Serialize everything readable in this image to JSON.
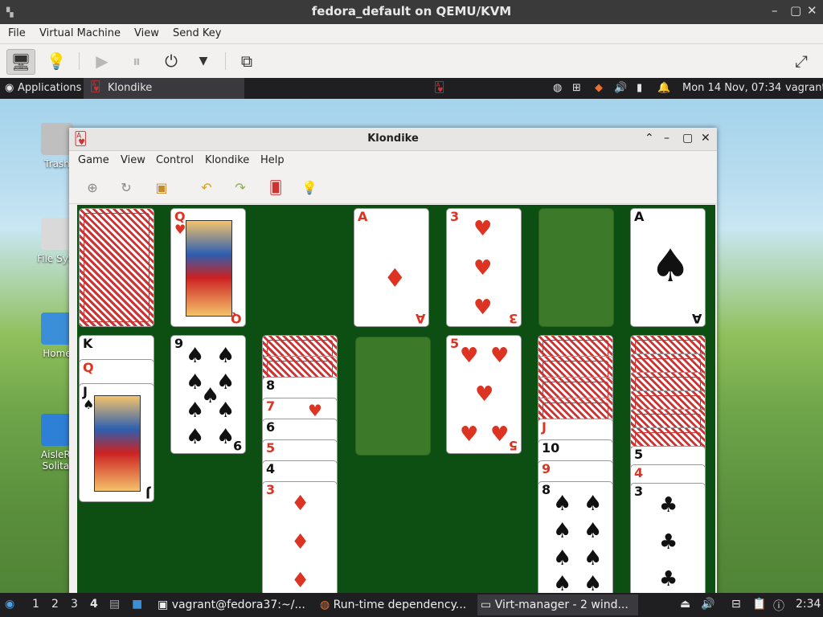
{
  "host": {
    "title": "fedora_default on QEMU/KVM",
    "menu": [
      "File",
      "Virtual Machine",
      "View",
      "Send Key"
    ]
  },
  "guest_panel": {
    "applications": "Applications",
    "active_app": "Klondike",
    "clock": "Mon 14 Nov, 07:34",
    "user": "vagrant"
  },
  "desktop_icons": [
    "Trash",
    "File Syst",
    "Home",
    "AisleRi Solitai"
  ],
  "klondike": {
    "title": "Klondike",
    "menu": [
      "Game",
      "View",
      "Control",
      "Klondike",
      "Help"
    ],
    "foundations": [
      {
        "rank": "A",
        "suit": "♦",
        "color": "red"
      },
      {
        "rank": "3",
        "suit": "♥",
        "color": "red"
      },
      {
        "rank": "",
        "suit": "",
        "color": ""
      },
      {
        "rank": "A",
        "suit": "♠",
        "color": "black"
      }
    ],
    "waste": {
      "rank": "Q",
      "suit": "♥",
      "color": "red"
    },
    "tableau": [
      {
        "visible": [
          {
            "rank": "K",
            "suit": "♠",
            "color": "black"
          },
          {
            "rank": "Q",
            "suit": "♥",
            "color": "red"
          },
          {
            "rank": "J",
            "suit": "♠",
            "color": "black"
          }
        ]
      },
      {
        "visible": [
          {
            "rank": "9",
            "suit": "♠",
            "color": "black"
          }
        ]
      },
      {
        "visible": [
          {
            "rank": "8",
            "suit": "♠",
            "color": "black"
          },
          {
            "rank": "7",
            "suit": "♥",
            "color": "red"
          },
          {
            "rank": "6",
            "suit": "♠",
            "color": "black"
          },
          {
            "rank": "5",
            "suit": "♦",
            "color": "red"
          },
          {
            "rank": "4",
            "suit": "♠",
            "color": "black"
          },
          {
            "rank": "3",
            "suit": "♦",
            "color": "red"
          }
        ]
      },
      {
        "visible": []
      },
      {
        "visible": [
          {
            "rank": "5",
            "suit": "♥",
            "color": "red"
          }
        ]
      },
      {
        "visible": [
          {
            "rank": "J",
            "suit": "♥",
            "color": "red"
          },
          {
            "rank": "10",
            "suit": "♠",
            "color": "black"
          },
          {
            "rank": "9",
            "suit": "♦",
            "color": "red"
          },
          {
            "rank": "8",
            "suit": "♠",
            "color": "black"
          }
        ]
      },
      {
        "visible": [
          {
            "rank": "5",
            "suit": "♠",
            "color": "black"
          },
          {
            "rank": "4",
            "suit": "♥",
            "color": "red"
          },
          {
            "rank": "3",
            "suit": "♣",
            "color": "black"
          }
        ]
      }
    ]
  },
  "taskbar": {
    "workspaces": [
      "1",
      "2",
      "3",
      "4"
    ],
    "tasks": [
      "vagrant@fedora37:~/...",
      "Run-time dependency...",
      "Virt-manager - 2 wind..."
    ],
    "time": "2:34"
  }
}
